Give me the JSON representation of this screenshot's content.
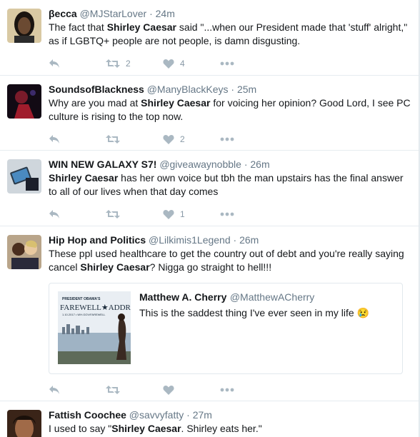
{
  "tweets": [
    {
      "name": "βecca",
      "handle": "@MJStarLover",
      "time": "24m",
      "text": [
        {
          "t": "The fact that "
        },
        {
          "t": "Shirley Caesar",
          "b": true
        },
        {
          "t": " said \"...when our President made that 'stuff' alright,\" as if LGBTQ+ people are not people, is damn disgusting."
        }
      ],
      "retweets": "2",
      "likes": "4"
    },
    {
      "name": "SoundsofBlackness",
      "handle": "@ManyBlackKeys",
      "time": "25m",
      "text": [
        {
          "t": "Why are you mad at "
        },
        {
          "t": "Shirley Caesar",
          "b": true
        },
        {
          "t": " for voicing her opinion? Good Lord, I see PC culture is rising to the top now."
        }
      ],
      "retweets": "",
      "likes": "2"
    },
    {
      "name": "WIN NEW GALAXY S7!",
      "handle": "@giveawaynobble",
      "time": "26m",
      "text": [
        {
          "t": "Shirley Caesar",
          "b": true
        },
        {
          "t": " has her own voice but tbh the man upstairs has the final answer to all of our lives when that day comes"
        }
      ],
      "retweets": "",
      "likes": "1"
    },
    {
      "name": "Hip Hop and Politics",
      "handle": "@Lilkimis1Legend",
      "time": "26m",
      "text": [
        {
          "t": "These ppl used healthcare to get the country out of debt and you're really saying cancel "
        },
        {
          "t": "Shirley Caesar",
          "b": true
        },
        {
          "t": "? Nigga go straight to hell!!!"
        }
      ],
      "quote": {
        "name": "Matthew A. Cherry",
        "handle": "@MatthewACherry",
        "text": "This is the saddest thing I've ever seen in my life 😢",
        "image_lines": [
          "PRESIDENT OBAMA'S",
          "FAREWELL★ADDRESS",
          "1.10.2017 • WH.GOV/FAREWELL"
        ]
      },
      "retweets": "",
      "likes": ""
    },
    {
      "name": "Fattish Coochee",
      "handle": "@savvyfatty",
      "time": "27m",
      "text": [
        {
          "t": "I used to say \""
        },
        {
          "t": "Shirley Caesar",
          "b": true
        },
        {
          "t": ". Shirley eats her.\""
        }
      ],
      "retweets": "",
      "likes": ""
    }
  ],
  "icons": {
    "reply": "reply-icon",
    "retweet": "retweet-icon",
    "like": "heart-icon",
    "more": "more-icon"
  },
  "colors": {
    "action_gray": "#aab8c2",
    "secondary_text": "#657786",
    "divider": "#e6ecf0"
  }
}
